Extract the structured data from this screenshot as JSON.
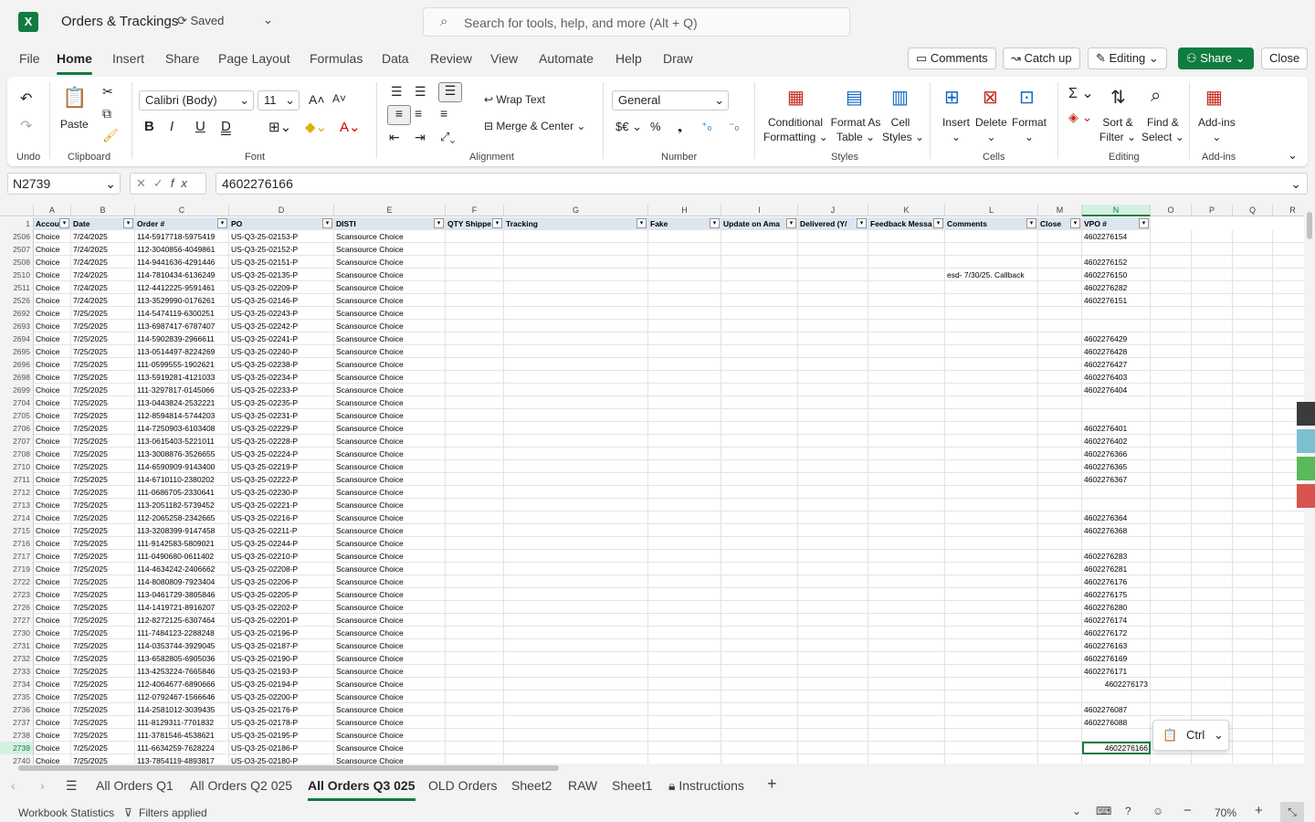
{
  "app": {
    "title": "Orders & Trackings",
    "saved": "Saved",
    "search_placeholder": "Search for tools, help, and more (Alt + Q)"
  },
  "menu": [
    "File",
    "Home",
    "Insert",
    "Share",
    "Page Layout",
    "Formulas",
    "Data",
    "Review",
    "View",
    "Automate",
    "Help",
    "Draw"
  ],
  "actions": {
    "comments": "Comments",
    "catchup": "Catch up",
    "editing": "Editing",
    "share": "Share",
    "close": "Close"
  },
  "ribbon": {
    "undo": "Undo",
    "paste": "Paste",
    "clipboard": "Clipboard",
    "font_name": "Calibri (Body)",
    "font_size": "11",
    "font": "Font",
    "wrap": "Wrap Text",
    "merge": "Merge & Center",
    "alignment": "Alignment",
    "number_format": "General",
    "number": "Number",
    "cond": "Conditional",
    "cond2": "Formatting",
    "fat": "Format As",
    "fat2": "Table",
    "cs": "Cell",
    "cs2": "Styles",
    "styles": "Styles",
    "insert": "Insert",
    "delete": "Delete",
    "format": "Format",
    "cells": "Cells",
    "sort": "Sort &",
    "sort2": "Filter",
    "find": "Find &",
    "find2": "Select",
    "editing": "Editing",
    "addins": "Add-ins",
    "addins_label": "Add-ins"
  },
  "formula_bar": {
    "namebox": "N2739",
    "value": "4602276166"
  },
  "columns": [
    "A",
    "B",
    "C",
    "D",
    "E",
    "F",
    "G",
    "H",
    "I",
    "J",
    "K",
    "L",
    "M",
    "N",
    "O",
    "P",
    "Q",
    "R"
  ],
  "headers": [
    "Accou",
    "Date",
    "Order #",
    "PO",
    "DISTI",
    "QTY Shippe",
    "Tracking",
    "Fake",
    "Update on Ama",
    "Delivered (Y/",
    "Feedback Messa",
    "Comments",
    "Close",
    "VPO #"
  ],
  "rows": [
    [
      "2506",
      "Choice",
      "7/24/2025",
      "114-5917718-5975419",
      "US-Q3-25-02153-P",
      "Scansource Choice",
      "",
      "4602276154"
    ],
    [
      "2507",
      "Choice",
      "7/24/2025",
      "112-3040856-4049861",
      "US-Q3-25-02152-P",
      "Scansource Choice",
      "",
      ""
    ],
    [
      "2508",
      "Choice",
      "7/24/2025",
      "114-9441636-4291446",
      "US-Q3-25-02151-P",
      "Scansource Choice",
      "",
      "4602276152"
    ],
    [
      "2510",
      "Choice",
      "7/24/2025",
      "114-7810434-6136249",
      "US-Q3-25-02135-P",
      "Scansource Choice",
      "esd- 7/30/25. Callback",
      "4602276150"
    ],
    [
      "2511",
      "Choice",
      "7/24/2025",
      "112-4412225-9591461",
      "US-Q3-25-02209-P",
      "Scansource Choice",
      "",
      "4602276282"
    ],
    [
      "2526",
      "Choice",
      "7/24/2025",
      "113-3529990-0176261",
      "US-Q3-25-02146-P",
      "Scansource Choice",
      "",
      "4602276151"
    ],
    [
      "2692",
      "Choice",
      "7/25/2025",
      "114-5474119-6300251",
      "US-Q3-25-02243-P",
      "Scansource Choice",
      "",
      ""
    ],
    [
      "2693",
      "Choice",
      "7/25/2025",
      "113-6987417-6787407",
      "US-Q3-25-02242-P",
      "Scansource Choice",
      "",
      ""
    ],
    [
      "2694",
      "Choice",
      "7/25/2025",
      "114-5902839-2966611",
      "US-Q3-25-02241-P",
      "Scansource Choice",
      "",
      "4602276429"
    ],
    [
      "2695",
      "Choice",
      "7/25/2025",
      "113-0514497-8224269",
      "US-Q3-25-02240-P",
      "Scansource Choice",
      "",
      "4602276428"
    ],
    [
      "2696",
      "Choice",
      "7/25/2025",
      "111-0599555-1902621",
      "US-Q3-25-02238-P",
      "Scansource Choice",
      "",
      "4602276427"
    ],
    [
      "2698",
      "Choice",
      "7/25/2025",
      "113-5919281-4121033",
      "US-Q3-25-02234-P",
      "Scansource Choice",
      "",
      "4602276403"
    ],
    [
      "2699",
      "Choice",
      "7/25/2025",
      "111-3297817-0145066",
      "US-Q3-25-02233-P",
      "Scansource Choice",
      "",
      "4602276404"
    ],
    [
      "2704",
      "Choice",
      "7/25/2025",
      "113-0443824-2532221",
      "US-Q3-25-02235-P",
      "Scansource Choice",
      "",
      ""
    ],
    [
      "2705",
      "Choice",
      "7/25/2025",
      "112-8594814-5744203",
      "US-Q3-25-02231-P",
      "Scansource Choice",
      "",
      ""
    ],
    [
      "2706",
      "Choice",
      "7/25/2025",
      "114-7250903-6103408",
      "US-Q3-25-02229-P",
      "Scansource Choice",
      "",
      "4602276401"
    ],
    [
      "2707",
      "Choice",
      "7/25/2025",
      "113-0615403-5221011",
      "US-Q3-25-02228-P",
      "Scansource Choice",
      "",
      "4602276402"
    ],
    [
      "2708",
      "Choice",
      "7/25/2025",
      "113-3008876-3526655",
      "US-Q3-25-02224-P",
      "Scansource Choice",
      "",
      "4602276366"
    ],
    [
      "2710",
      "Choice",
      "7/25/2025",
      "114-6590909-9143400",
      "US-Q3-25-02219-P",
      "Scansource Choice",
      "",
      "4602276365"
    ],
    [
      "2711",
      "Choice",
      "7/25/2025",
      "114-6710110-2380202",
      "US-Q3-25-02222-P",
      "Scansource Choice",
      "",
      "4602276367"
    ],
    [
      "2712",
      "Choice",
      "7/25/2025",
      "111-0686705-2330641",
      "US-Q3-25-02230-P",
      "Scansource Choice",
      "",
      ""
    ],
    [
      "2713",
      "Choice",
      "7/25/2025",
      "113-2051182-5739452",
      "US-Q3-25-02221-P",
      "Scansource Choice",
      "",
      ""
    ],
    [
      "2714",
      "Choice",
      "7/25/2025",
      "112-2065258-2342665",
      "US-Q3-25-02216-P",
      "Scansource Choice",
      "",
      "4602276364"
    ],
    [
      "2715",
      "Choice",
      "7/25/2025",
      "113-3208399-9147458",
      "US-Q3-25-02211-P",
      "Scansource Choice",
      "",
      "4602276368"
    ],
    [
      "2716",
      "Choice",
      "7/25/2025",
      "111-9142583-5809021",
      "US-Q3-25-02244-P",
      "Scansource Choice",
      "",
      ""
    ],
    [
      "2717",
      "Choice",
      "7/25/2025",
      "111-0490680-0611402",
      "US-Q3-25-02210-P",
      "Scansource Choice",
      "",
      "4602276283"
    ],
    [
      "2719",
      "Choice",
      "7/25/2025",
      "114-4634242-2406662",
      "US-Q3-25-02208-P",
      "Scansource Choice",
      "",
      "4602276281"
    ],
    [
      "2722",
      "Choice",
      "7/25/2025",
      "114-8080809-7923404",
      "US-Q3-25-02206-P",
      "Scansource Choice",
      "",
      "4602276176"
    ],
    [
      "2723",
      "Choice",
      "7/25/2025",
      "113-0461729-3805846",
      "US-Q3-25-02205-P",
      "Scansource Choice",
      "",
      "4602276175"
    ],
    [
      "2726",
      "Choice",
      "7/25/2025",
      "114-1419721-8916207",
      "US-Q3-25-02202-P",
      "Scansource Choice",
      "",
      "4602276280"
    ],
    [
      "2727",
      "Choice",
      "7/25/2025",
      "112-8272125-6307464",
      "US-Q3-25-02201-P",
      "Scansource Choice",
      "",
      "4602276174"
    ],
    [
      "2730",
      "Choice",
      "7/25/2025",
      "111-7484123-2288248",
      "US-Q3-25-02196-P",
      "Scansource Choice",
      "",
      "4602276172"
    ],
    [
      "2731",
      "Choice",
      "7/25/2025",
      "114-0353744-3929045",
      "US-Q3-25-02187-P",
      "Scansource Choice",
      "",
      "4602276163"
    ],
    [
      "2732",
      "Choice",
      "7/25/2025",
      "113-6582805-6905036",
      "US-Q3-25-02190-P",
      "Scansource Choice",
      "",
      "4602276169"
    ],
    [
      "2733",
      "Choice",
      "7/25/2025",
      "113-4253224-7665846",
      "US-Q3-25-02193-P",
      "Scansource Choice",
      "",
      "4602276171"
    ],
    [
      "2734",
      "Choice",
      "7/25/2025",
      "112-4064677-6890666",
      "US-Q3-25-02194-P",
      "Scansource Choice",
      "",
      "4602276173"
    ],
    [
      "2735",
      "Choice",
      "7/25/2025",
      "112-0792467-1566646",
      "US-Q3-25-02200-P",
      "Scansource Choice",
      "",
      ""
    ],
    [
      "2736",
      "Choice",
      "7/25/2025",
      "114-2581012-3039435",
      "US-Q3-25-02176-P",
      "Scansource Choice",
      "",
      "4602276087"
    ],
    [
      "2737",
      "Choice",
      "7/25/2025",
      "111-8129311-7701832",
      "US-Q3-25-02178-P",
      "Scansource Choice",
      "",
      "4602276088"
    ],
    [
      "2738",
      "Choice",
      "7/25/2025",
      "111-3781546-4538621",
      "US-Q3-25-02195-P",
      "Scansource Choice",
      "",
      ""
    ],
    [
      "2739",
      "Choice",
      "7/25/2025",
      "111-6634259-7628224",
      "US-Q3-25-02186-P",
      "Scansource Choice",
      "",
      "4602276166"
    ],
    [
      "2740",
      "Choice",
      "7/25/2025",
      "113-7854119-4893817",
      "US-Q3-25-02180-P",
      "Scansource Choice",
      "",
      ""
    ]
  ],
  "sheets": [
    "All Orders Q1",
    "All Orders Q2 025",
    "All Orders Q3 025",
    "OLD Orders",
    "Sheet2",
    "RAW",
    "Sheet1",
    "Instructions"
  ],
  "status": {
    "stats": "Workbook Statistics",
    "filters": "Filters applied",
    "zoom": "70%"
  },
  "ctrl": "Ctrl",
  "colors": {
    "accent": "#107c41",
    "header_fill": "#dce6f1"
  }
}
